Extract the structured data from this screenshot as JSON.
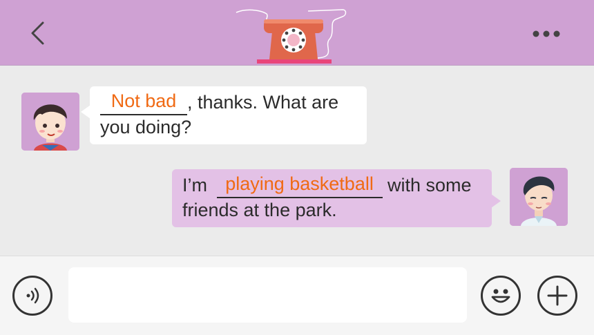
{
  "header": {
    "back_icon": "chevron-left-icon",
    "logo_icon": "telephone-icon",
    "more_icon": "more-dots-icon",
    "background": "#cfa1d3"
  },
  "messages": [
    {
      "side": "left",
      "avatar": "boy-avatar-icon",
      "blank_answer": "Not bad",
      "text_after_blank": ", thanks. What are",
      "text_line2": "you doing?"
    },
    {
      "side": "right",
      "avatar": "young-man-avatar-icon",
      "text_before_blank": "I’m",
      "blank_answer": "playing basketball",
      "text_after_blank": " with some",
      "text_line2": "friends at the park."
    }
  ],
  "input_bar": {
    "voice_icon": "voice-icon",
    "message_value": "",
    "emoji_icon": "smiley-icon",
    "add_icon": "plus-icon"
  },
  "colors": {
    "answer": "#f06a14",
    "right_bubble": "#e3c1e6",
    "left_bubble": "#ffffff"
  }
}
